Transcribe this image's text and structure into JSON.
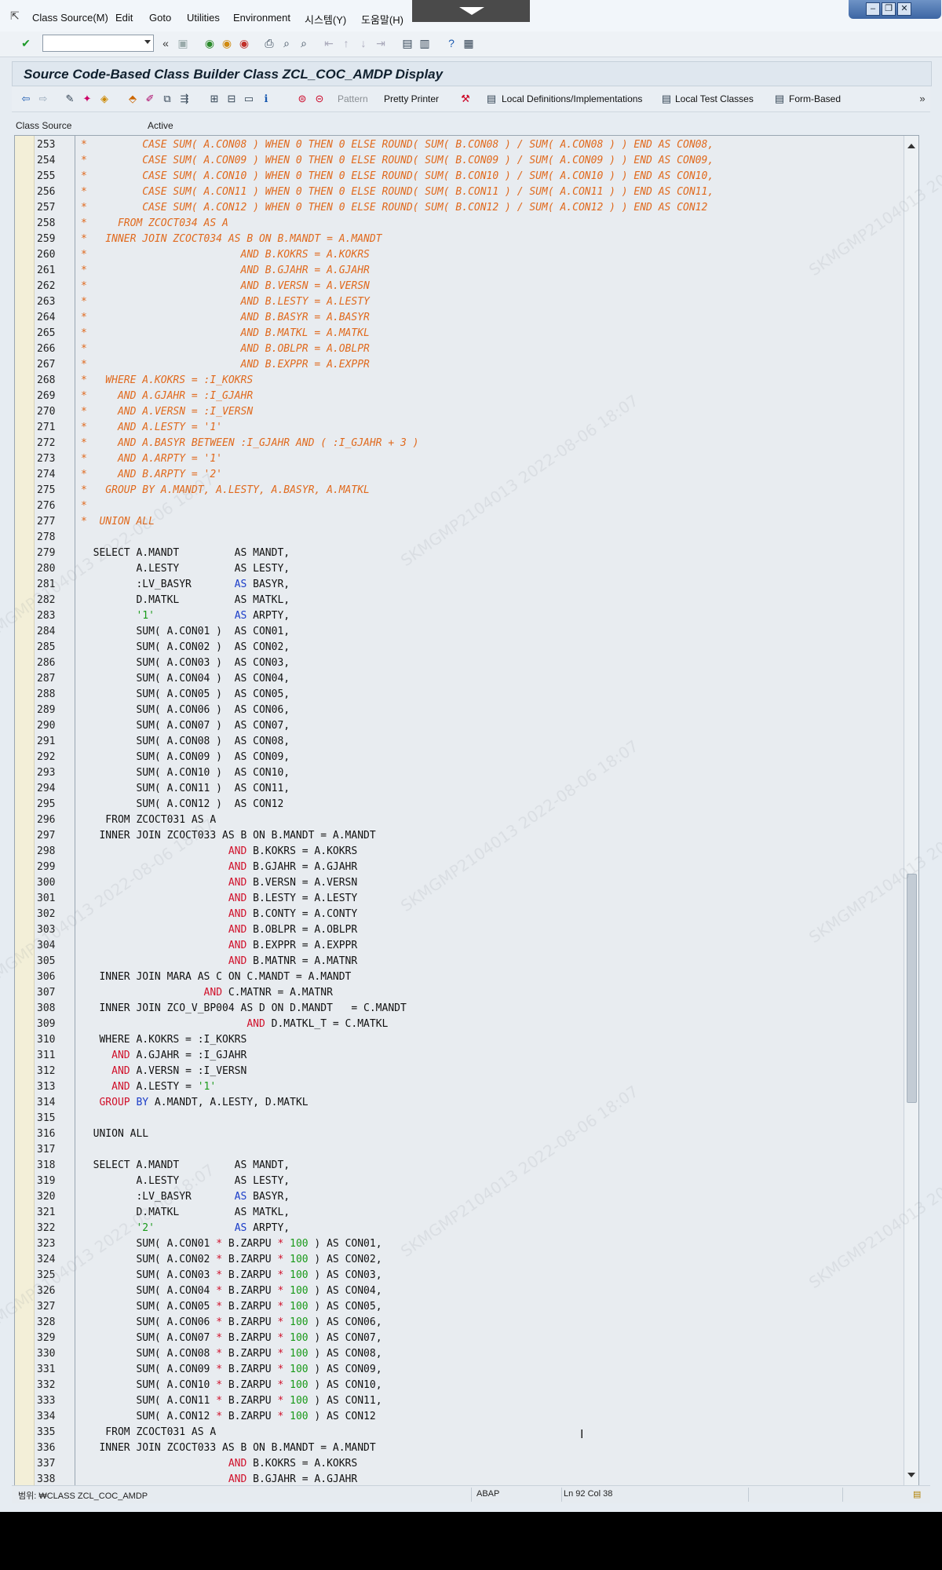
{
  "menubar": {
    "items": [
      {
        "label": "Class Source",
        "hotkey": "(M)"
      },
      {
        "label": "Edit",
        "hotkey": ""
      },
      {
        "label": "Goto",
        "hotkey": ""
      },
      {
        "label": "Utilities",
        "hotkey": ""
      },
      {
        "label": "Environment",
        "hotkey": ""
      },
      {
        "label": "시스템",
        "hotkey": "(Y)"
      },
      {
        "label": "도움말",
        "hotkey": "(H)"
      }
    ]
  },
  "command_field": {
    "value": ""
  },
  "title": "Source Code-Based Class Builder Class ZCL_COC_AMDP Display",
  "app_toolbar": {
    "pattern": "Pattern",
    "pretty_printer": "Pretty Printer",
    "local_defs": "Local Definitions/Implementations",
    "local_tests": "Local Test Classes",
    "form_based": "Form-Based"
  },
  "header": {
    "class_source": "Class Source",
    "active": "Active"
  },
  "editor": {
    "lines": [
      {
        "n": "253",
        "t": "*         CASE SUM( A.CON08 ) WHEN 0 THEN 0 ELSE ROUND( SUM( B.CON08 ) / SUM( A.CON08 ) ) END AS CON08,",
        "c": true
      },
      {
        "n": "254",
        "t": "*         CASE SUM( A.CON09 ) WHEN 0 THEN 0 ELSE ROUND( SUM( B.CON09 ) / SUM( A.CON09 ) ) END AS CON09,",
        "c": true
      },
      {
        "n": "255",
        "t": "*         CASE SUM( A.CON10 ) WHEN 0 THEN 0 ELSE ROUND( SUM( B.CON10 ) / SUM( A.CON10 ) ) END AS CON10,",
        "c": true
      },
      {
        "n": "256",
        "t": "*         CASE SUM( A.CON11 ) WHEN 0 THEN 0 ELSE ROUND( SUM( B.CON11 ) / SUM( A.CON11 ) ) END AS CON11,",
        "c": true
      },
      {
        "n": "257",
        "t": "*         CASE SUM( A.CON12 ) WHEN 0 THEN 0 ELSE ROUND( SUM( B.CON12 ) / SUM( A.CON12 ) ) END AS CON12",
        "c": true
      },
      {
        "n": "258",
        "t": "*     FROM ZCOCT034 AS A",
        "c": true
      },
      {
        "n": "259",
        "t": "*   INNER JOIN ZCOCT034 AS B ON B.MANDT = A.MANDT",
        "c": true
      },
      {
        "n": "260",
        "t": "*                         AND B.KOKRS = A.KOKRS",
        "c": true
      },
      {
        "n": "261",
        "t": "*                         AND B.GJAHR = A.GJAHR",
        "c": true
      },
      {
        "n": "262",
        "t": "*                         AND B.VERSN = A.VERSN",
        "c": true
      },
      {
        "n": "263",
        "t": "*                         AND B.LESTY = A.LESTY",
        "c": true
      },
      {
        "n": "264",
        "t": "*                         AND B.BASYR = A.BASYR",
        "c": true
      },
      {
        "n": "265",
        "t": "*                         AND B.MATKL = A.MATKL",
        "c": true
      },
      {
        "n": "266",
        "t": "*                         AND B.OBLPR = A.OBLPR",
        "c": true
      },
      {
        "n": "267",
        "t": "*                         AND B.EXPPR = A.EXPPR",
        "c": true
      },
      {
        "n": "268",
        "t": "*   WHERE A.KOKRS = :I_KOKRS",
        "c": true
      },
      {
        "n": "269",
        "t": "*     AND A.GJAHR = :I_GJAHR",
        "c": true
      },
      {
        "n": "270",
        "t": "*     AND A.VERSN = :I_VERSN",
        "c": true
      },
      {
        "n": "271",
        "t": "*     AND A.LESTY = '1'",
        "c": true
      },
      {
        "n": "272",
        "t": "*     AND A.BASYR BETWEEN :I_GJAHR AND ( :I_GJAHR + 3 )",
        "c": true
      },
      {
        "n": "273",
        "t": "*     AND A.ARPTY = '1'",
        "c": true
      },
      {
        "n": "274",
        "t": "*     AND B.ARPTY = '2'",
        "c": true
      },
      {
        "n": "275",
        "t": "*   GROUP BY A.MANDT, A.LESTY, A.BASYR, A.MATKL",
        "c": true
      },
      {
        "n": "276",
        "t": "*",
        "c": true
      },
      {
        "n": "277",
        "t": "*  UNION ALL",
        "c": true
      },
      {
        "n": "278",
        "t": "",
        "c": false
      },
      {
        "n": "279",
        "t": "  SELECT A.MANDT         AS MANDT,",
        "c": false
      },
      {
        "n": "280",
        "t": "         A.LESTY         AS LESTY,",
        "c": false
      },
      {
        "n": "281",
        "t": "         :LV_BASYR       AS BASYR,",
        "c": false
      },
      {
        "n": "282",
        "t": "         D.MATKL         AS MATKL,",
        "c": false
      },
      {
        "n": "283",
        "t": "         '1'             AS ARPTY,",
        "c": false
      },
      {
        "n": "284",
        "t": "         SUM( A.CON01 )  AS CON01,",
        "c": false
      },
      {
        "n": "285",
        "t": "         SUM( A.CON02 )  AS CON02,",
        "c": false
      },
      {
        "n": "286",
        "t": "         SUM( A.CON03 )  AS CON03,",
        "c": false
      },
      {
        "n": "287",
        "t": "         SUM( A.CON04 )  AS CON04,",
        "c": false
      },
      {
        "n": "288",
        "t": "         SUM( A.CON05 )  AS CON05,",
        "c": false
      },
      {
        "n": "289",
        "t": "         SUM( A.CON06 )  AS CON06,",
        "c": false
      },
      {
        "n": "290",
        "t": "         SUM( A.CON07 )  AS CON07,",
        "c": false
      },
      {
        "n": "291",
        "t": "         SUM( A.CON08 )  AS CON08,",
        "c": false
      },
      {
        "n": "292",
        "t": "         SUM( A.CON09 )  AS CON09,",
        "c": false
      },
      {
        "n": "293",
        "t": "         SUM( A.CON10 )  AS CON10,",
        "c": false
      },
      {
        "n": "294",
        "t": "         SUM( A.CON11 )  AS CON11,",
        "c": false
      },
      {
        "n": "295",
        "t": "         SUM( A.CON12 )  AS CON12",
        "c": false
      },
      {
        "n": "296",
        "t": "    FROM ZCOCT031 AS A",
        "c": false
      },
      {
        "n": "297",
        "t": "   INNER JOIN ZCOCT033 AS B ON B.MANDT = A.MANDT",
        "c": false
      },
      {
        "n": "298",
        "t": "                        AND B.KOKRS = A.KOKRS",
        "c": false
      },
      {
        "n": "299",
        "t": "                        AND B.GJAHR = A.GJAHR",
        "c": false
      },
      {
        "n": "300",
        "t": "                        AND B.VERSN = A.VERSN",
        "c": false
      },
      {
        "n": "301",
        "t": "                        AND B.LESTY = A.LESTY",
        "c": false
      },
      {
        "n": "302",
        "t": "                        AND B.CONTY = A.CONTY",
        "c": false
      },
      {
        "n": "303",
        "t": "                        AND B.OBLPR = A.OBLPR",
        "c": false
      },
      {
        "n": "304",
        "t": "                        AND B.EXPPR = A.EXPPR",
        "c": false
      },
      {
        "n": "305",
        "t": "                        AND B.MATNR = A.MATNR",
        "c": false
      },
      {
        "n": "306",
        "t": "   INNER JOIN MARA AS C ON C.MANDT = A.MANDT",
        "c": false
      },
      {
        "n": "307",
        "t": "                    AND C.MATNR = A.MATNR",
        "c": false
      },
      {
        "n": "308",
        "t": "   INNER JOIN ZCO_V_BP004 AS D ON D.MANDT   = C.MANDT",
        "c": false
      },
      {
        "n": "309",
        "t": "                           AND D.MATKL_T = C.MATKL",
        "c": false
      },
      {
        "n": "310",
        "t": "   WHERE A.KOKRS = :I_KOKRS",
        "c": false
      },
      {
        "n": "311",
        "t": "     AND A.GJAHR = :I_GJAHR",
        "c": false
      },
      {
        "n": "312",
        "t": "     AND A.VERSN = :I_VERSN",
        "c": false
      },
      {
        "n": "313",
        "t": "     AND A.LESTY = '1'",
        "c": false
      },
      {
        "n": "314",
        "t": "   GROUP BY A.MANDT, A.LESTY, D.MATKL",
        "c": false
      },
      {
        "n": "315",
        "t": "",
        "c": false
      },
      {
        "n": "316",
        "t": "  UNION ALL",
        "c": false
      },
      {
        "n": "317",
        "t": "",
        "c": false
      },
      {
        "n": "318",
        "t": "  SELECT A.MANDT         AS MANDT,",
        "c": false
      },
      {
        "n": "319",
        "t": "         A.LESTY         AS LESTY,",
        "c": false
      },
      {
        "n": "320",
        "t": "         :LV_BASYR       AS BASYR,",
        "c": false
      },
      {
        "n": "321",
        "t": "         D.MATKL         AS MATKL,",
        "c": false
      },
      {
        "n": "322",
        "t": "         '2'             AS ARPTY,",
        "c": false
      },
      {
        "n": "323",
        "t": "         SUM( A.CON01 * B.ZARPU * 100 ) AS CON01,",
        "c": false
      },
      {
        "n": "324",
        "t": "         SUM( A.CON02 * B.ZARPU * 100 ) AS CON02,",
        "c": false
      },
      {
        "n": "325",
        "t": "         SUM( A.CON03 * B.ZARPU * 100 ) AS CON03,",
        "c": false
      },
      {
        "n": "326",
        "t": "         SUM( A.CON04 * B.ZARPU * 100 ) AS CON04,",
        "c": false
      },
      {
        "n": "327",
        "t": "         SUM( A.CON05 * B.ZARPU * 100 ) AS CON05,",
        "c": false
      },
      {
        "n": "328",
        "t": "         SUM( A.CON06 * B.ZARPU * 100 ) AS CON06,",
        "c": false
      },
      {
        "n": "329",
        "t": "         SUM( A.CON07 * B.ZARPU * 100 ) AS CON07,",
        "c": false
      },
      {
        "n": "330",
        "t": "         SUM( A.CON08 * B.ZARPU * 100 ) AS CON08,",
        "c": false
      },
      {
        "n": "331",
        "t": "         SUM( A.CON09 * B.ZARPU * 100 ) AS CON09,",
        "c": false
      },
      {
        "n": "332",
        "t": "         SUM( A.CON10 * B.ZARPU * 100 ) AS CON10,",
        "c": false
      },
      {
        "n": "333",
        "t": "         SUM( A.CON11 * B.ZARPU * 100 ) AS CON11,",
        "c": false
      },
      {
        "n": "334",
        "t": "         SUM( A.CON12 * B.ZARPU * 100 ) AS CON12",
        "c": false
      },
      {
        "n": "335",
        "t": "    FROM ZCOCT031 AS A",
        "c": false
      },
      {
        "n": "336",
        "t": "   INNER JOIN ZCOCT033 AS B ON B.MANDT = A.MANDT",
        "c": false
      },
      {
        "n": "337",
        "t": "                        AND B.KOKRS = A.KOKRS",
        "c": false
      },
      {
        "n": "338",
        "t": "                        AND B.GJAHR = A.GJAHR",
        "c": false
      }
    ]
  },
  "status": {
    "scope": "범위: ₩CLASS ZCL_COC_AMDP",
    "language": "ABAP",
    "position": "Ln  92 Col  38"
  },
  "watermark": "SKMGMP2104013 2022-08-06 18:07",
  "colors": {
    "comment": "#e06a1e",
    "keyword": "#1a3cc8",
    "and_kw": "#d0102a",
    "literal": "#1a9a1a"
  }
}
